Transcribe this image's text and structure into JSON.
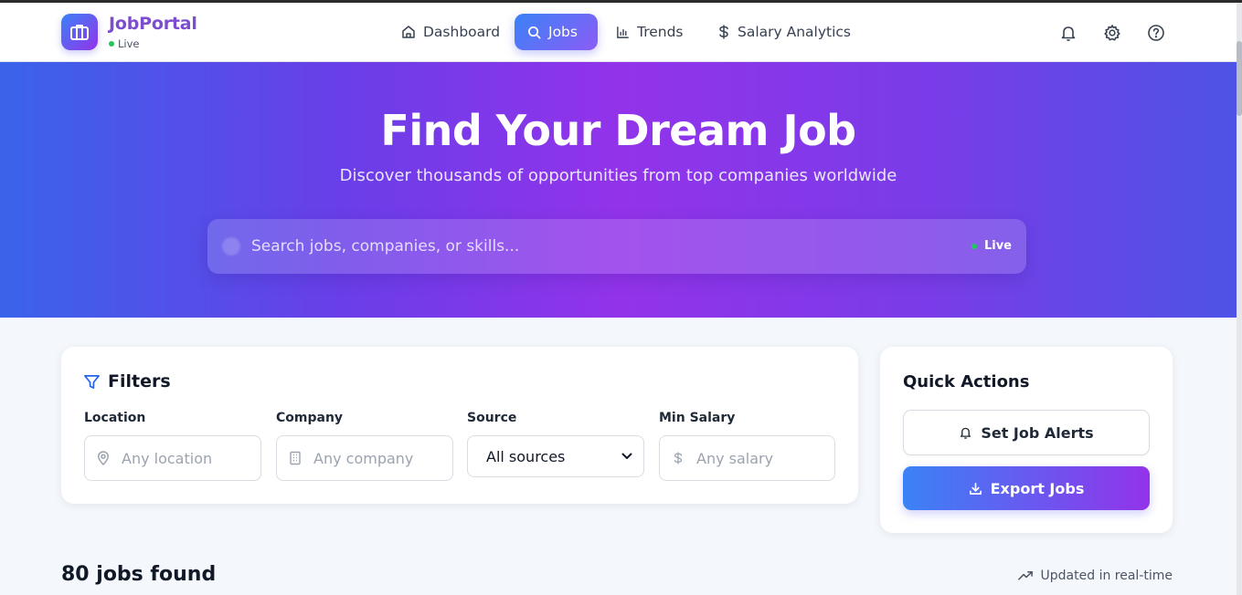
{
  "brand": {
    "name": "JobPortal",
    "status": "Live"
  },
  "nav": [
    {
      "label": "Dashboard",
      "icon": "home-icon",
      "active": false
    },
    {
      "label": "Jobs",
      "icon": "search-icon",
      "active": true
    },
    {
      "label": "Trends",
      "icon": "bar-chart-icon",
      "active": false
    },
    {
      "label": "Salary Analytics",
      "icon": "dollar-icon",
      "active": false
    }
  ],
  "header_icons": [
    "bell-icon",
    "gear-icon",
    "help-icon"
  ],
  "hero": {
    "title": "Find Your Dream Job",
    "subtitle": "Discover thousands of opportunities from top companies worldwide",
    "search_placeholder": "Search jobs, companies, or skills...",
    "search_status": "Live"
  },
  "filters": {
    "title": "Filters",
    "location": {
      "label": "Location",
      "placeholder": "Any location"
    },
    "company": {
      "label": "Company",
      "placeholder": "Any company"
    },
    "source": {
      "label": "Source",
      "selected": "All sources"
    },
    "min_salary": {
      "label": "Min Salary",
      "placeholder": "Any salary"
    }
  },
  "quick_actions": {
    "title": "Quick Actions",
    "alerts_label": "Set Job Alerts",
    "export_label": "Export Jobs"
  },
  "results": {
    "count_text": "80 jobs found",
    "updated_text": "Updated in real-time"
  },
  "colors": {
    "accent_start": "#3b82f6",
    "accent_end": "#9333ea",
    "live_dot": "#22c55e"
  }
}
